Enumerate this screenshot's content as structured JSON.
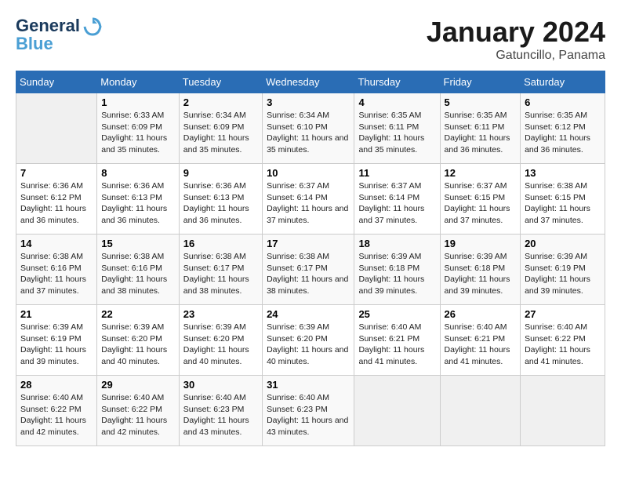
{
  "header": {
    "logo_line1": "General",
    "logo_line2": "Blue",
    "month": "January 2024",
    "location": "Gatuncillo, Panama"
  },
  "days_of_week": [
    "Sunday",
    "Monday",
    "Tuesday",
    "Wednesday",
    "Thursday",
    "Friday",
    "Saturday"
  ],
  "weeks": [
    [
      {
        "day": "",
        "sunrise": "",
        "sunset": "",
        "daylight": ""
      },
      {
        "day": "1",
        "sunrise": "Sunrise: 6:33 AM",
        "sunset": "Sunset: 6:09 PM",
        "daylight": "Daylight: 11 hours and 35 minutes."
      },
      {
        "day": "2",
        "sunrise": "Sunrise: 6:34 AM",
        "sunset": "Sunset: 6:09 PM",
        "daylight": "Daylight: 11 hours and 35 minutes."
      },
      {
        "day": "3",
        "sunrise": "Sunrise: 6:34 AM",
        "sunset": "Sunset: 6:10 PM",
        "daylight": "Daylight: 11 hours and 35 minutes."
      },
      {
        "day": "4",
        "sunrise": "Sunrise: 6:35 AM",
        "sunset": "Sunset: 6:11 PM",
        "daylight": "Daylight: 11 hours and 35 minutes."
      },
      {
        "day": "5",
        "sunrise": "Sunrise: 6:35 AM",
        "sunset": "Sunset: 6:11 PM",
        "daylight": "Daylight: 11 hours and 36 minutes."
      },
      {
        "day": "6",
        "sunrise": "Sunrise: 6:35 AM",
        "sunset": "Sunset: 6:12 PM",
        "daylight": "Daylight: 11 hours and 36 minutes."
      }
    ],
    [
      {
        "day": "7",
        "sunrise": "Sunrise: 6:36 AM",
        "sunset": "Sunset: 6:12 PM",
        "daylight": "Daylight: 11 hours and 36 minutes."
      },
      {
        "day": "8",
        "sunrise": "Sunrise: 6:36 AM",
        "sunset": "Sunset: 6:13 PM",
        "daylight": "Daylight: 11 hours and 36 minutes."
      },
      {
        "day": "9",
        "sunrise": "Sunrise: 6:36 AM",
        "sunset": "Sunset: 6:13 PM",
        "daylight": "Daylight: 11 hours and 36 minutes."
      },
      {
        "day": "10",
        "sunrise": "Sunrise: 6:37 AM",
        "sunset": "Sunset: 6:14 PM",
        "daylight": "Daylight: 11 hours and 37 minutes."
      },
      {
        "day": "11",
        "sunrise": "Sunrise: 6:37 AM",
        "sunset": "Sunset: 6:14 PM",
        "daylight": "Daylight: 11 hours and 37 minutes."
      },
      {
        "day": "12",
        "sunrise": "Sunrise: 6:37 AM",
        "sunset": "Sunset: 6:15 PM",
        "daylight": "Daylight: 11 hours and 37 minutes."
      },
      {
        "day": "13",
        "sunrise": "Sunrise: 6:38 AM",
        "sunset": "Sunset: 6:15 PM",
        "daylight": "Daylight: 11 hours and 37 minutes."
      }
    ],
    [
      {
        "day": "14",
        "sunrise": "Sunrise: 6:38 AM",
        "sunset": "Sunset: 6:16 PM",
        "daylight": "Daylight: 11 hours and 37 minutes."
      },
      {
        "day": "15",
        "sunrise": "Sunrise: 6:38 AM",
        "sunset": "Sunset: 6:16 PM",
        "daylight": "Daylight: 11 hours and 38 minutes."
      },
      {
        "day": "16",
        "sunrise": "Sunrise: 6:38 AM",
        "sunset": "Sunset: 6:17 PM",
        "daylight": "Daylight: 11 hours and 38 minutes."
      },
      {
        "day": "17",
        "sunrise": "Sunrise: 6:38 AM",
        "sunset": "Sunset: 6:17 PM",
        "daylight": "Daylight: 11 hours and 38 minutes."
      },
      {
        "day": "18",
        "sunrise": "Sunrise: 6:39 AM",
        "sunset": "Sunset: 6:18 PM",
        "daylight": "Daylight: 11 hours and 39 minutes."
      },
      {
        "day": "19",
        "sunrise": "Sunrise: 6:39 AM",
        "sunset": "Sunset: 6:18 PM",
        "daylight": "Daylight: 11 hours and 39 minutes."
      },
      {
        "day": "20",
        "sunrise": "Sunrise: 6:39 AM",
        "sunset": "Sunset: 6:19 PM",
        "daylight": "Daylight: 11 hours and 39 minutes."
      }
    ],
    [
      {
        "day": "21",
        "sunrise": "Sunrise: 6:39 AM",
        "sunset": "Sunset: 6:19 PM",
        "daylight": "Daylight: 11 hours and 39 minutes."
      },
      {
        "day": "22",
        "sunrise": "Sunrise: 6:39 AM",
        "sunset": "Sunset: 6:20 PM",
        "daylight": "Daylight: 11 hours and 40 minutes."
      },
      {
        "day": "23",
        "sunrise": "Sunrise: 6:39 AM",
        "sunset": "Sunset: 6:20 PM",
        "daylight": "Daylight: 11 hours and 40 minutes."
      },
      {
        "day": "24",
        "sunrise": "Sunrise: 6:39 AM",
        "sunset": "Sunset: 6:20 PM",
        "daylight": "Daylight: 11 hours and 40 minutes."
      },
      {
        "day": "25",
        "sunrise": "Sunrise: 6:40 AM",
        "sunset": "Sunset: 6:21 PM",
        "daylight": "Daylight: 11 hours and 41 minutes."
      },
      {
        "day": "26",
        "sunrise": "Sunrise: 6:40 AM",
        "sunset": "Sunset: 6:21 PM",
        "daylight": "Daylight: 11 hours and 41 minutes."
      },
      {
        "day": "27",
        "sunrise": "Sunrise: 6:40 AM",
        "sunset": "Sunset: 6:22 PM",
        "daylight": "Daylight: 11 hours and 41 minutes."
      }
    ],
    [
      {
        "day": "28",
        "sunrise": "Sunrise: 6:40 AM",
        "sunset": "Sunset: 6:22 PM",
        "daylight": "Daylight: 11 hours and 42 minutes."
      },
      {
        "day": "29",
        "sunrise": "Sunrise: 6:40 AM",
        "sunset": "Sunset: 6:22 PM",
        "daylight": "Daylight: 11 hours and 42 minutes."
      },
      {
        "day": "30",
        "sunrise": "Sunrise: 6:40 AM",
        "sunset": "Sunset: 6:23 PM",
        "daylight": "Daylight: 11 hours and 43 minutes."
      },
      {
        "day": "31",
        "sunrise": "Sunrise: 6:40 AM",
        "sunset": "Sunset: 6:23 PM",
        "daylight": "Daylight: 11 hours and 43 minutes."
      },
      {
        "day": "",
        "sunrise": "",
        "sunset": "",
        "daylight": ""
      },
      {
        "day": "",
        "sunrise": "",
        "sunset": "",
        "daylight": ""
      },
      {
        "day": "",
        "sunrise": "",
        "sunset": "",
        "daylight": ""
      }
    ]
  ]
}
